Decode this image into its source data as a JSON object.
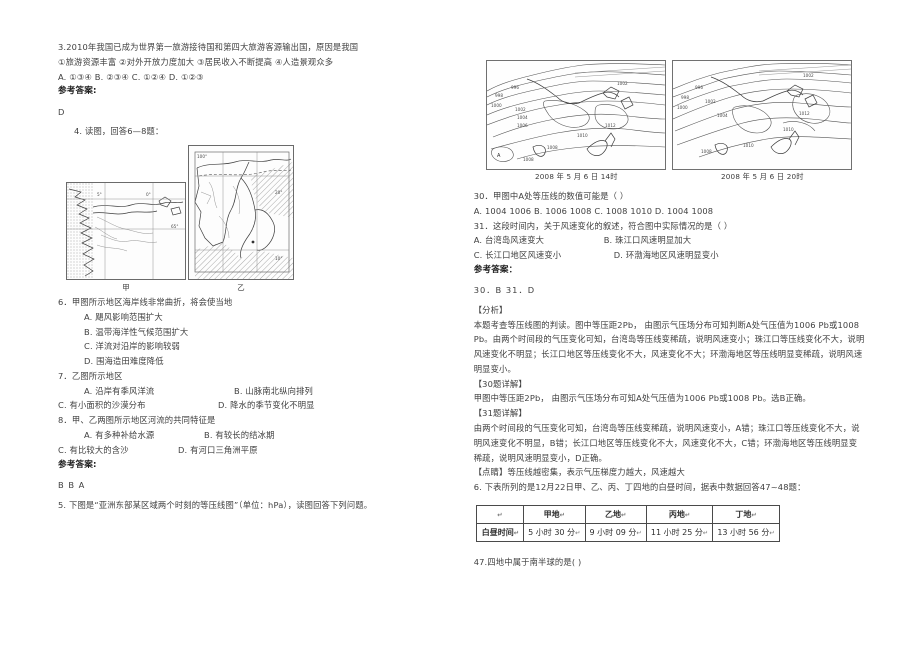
{
  "left_column": {
    "q3": {
      "stem": "3.2010年我国已成为世界第一旅游接待国和第四大旅游客源输出国，原因是我国",
      "choices_line": "①旅游资源丰富        ②对外开放力度加大   ③居民收入不断提高      ④人造景观众多",
      "options_line": "A.  ①③④        B.  ②③④      C.  ①②④      D.  ①②③",
      "answer_label": "参考答案:",
      "answer": "D"
    },
    "q4": {
      "stem": "4. 读图，回答6—8题："
    },
    "figure": {
      "caption_jia": "甲",
      "caption_yi": "乙",
      "jia_labels": [
        "5°",
        "0°",
        "65°"
      ],
      "yi_labels": [
        "100°",
        "20°",
        "10°"
      ]
    },
    "q6": {
      "stem": "6．甲图所示地区海岸线非常曲折，将会使当地",
      "options": [
        "A. 飓风影响范围扩大",
        "B. 温带海洋性气候范围扩大",
        "C. 洋流对沿岸的影响较弱",
        "D. 围海造田难度降低"
      ]
    },
    "q7": {
      "stem": "7．乙图所示地区",
      "options_row1": [
        "A. 沿岸有季风洋流",
        "B. 山脉南北纵向排列"
      ],
      "options_row2": [
        "C. 有小面积的沙漠分布",
        "D. 降水的季节变化不明显"
      ]
    },
    "q8": {
      "stem": "8．甲、乙两图所示地区河流的共同特征是",
      "options_row1": [
        "A. 有多种补给水源",
        "B. 有较长的结冰期"
      ],
      "options_row2": [
        "C. 有比较大的含沙",
        "D. 有河口三角洲平原"
      ],
      "answer_label": "参考答案:",
      "answer": "B  B A"
    },
    "q5": {
      "stem": "5. 下图是“亚洲东部某区域两个时刻的等压线图”（单位：hPa），读图回答下列问题。"
    }
  },
  "right_column": {
    "figure": {
      "caption_left": "2008 年 5 月 6 日 14时",
      "caption_right": "2008 年 5 月 6 日 20时",
      "point_label": "A",
      "isobar_values": [
        "996",
        "998",
        "1000",
        "1002",
        "1004",
        "1006",
        "1008",
        "1010",
        "1012"
      ]
    },
    "q30": {
      "stem": "30．甲图中A处等压线的数值可能是（  ）",
      "options_line": "A.  1004      1006      B.  1006      1008      C.  1008      1010      D.  1004      1008"
    },
    "q31": {
      "stem": "31．这段时间内，关于风速变化的叙述，符合图中实际情况的是（  ）",
      "options_row1": [
        "A.  台湾岛风速变大",
        "B.  珠江口风速明显加大"
      ],
      "options_row2": [
        "C.  长江口地区风速变小",
        "D.  环渤海地区风速明显变小"
      ]
    },
    "answer_label": "参考答案：",
    "answers": "30．B     31．D",
    "analysis_title": "【分析】",
    "analysis_body": "本题考查等压线图的判读。图中等压距2Pb，  由图示气压场分布可知判断A处气压值为1006 Pb或1008 Pb。由两个时间段的气压变化可知，台湾岛等压线变稀疏，说明风速变小；珠江口等压线变化不大，说明风速变化不明显；长江口地区等压线变化不大，风速变化不大；环渤海地区等压线明显变稀疏，说明风速明显变小。",
    "detail30_title": "【30题详解】",
    "detail30_body": "甲图中等压距2Pb，  由图示气压场分布可知A处气压值为1006 Pb或1008 Pb。选B正确。",
    "detail31_title": "【31题详解】",
    "detail31_body": "由两个时间段的气压变化可知，台湾岛等压线变稀疏，说明风速变小，A错；珠江口等压线变化不大，说明风速变化不明显，B错；长江口地区等压线变化不大，风速变化不大，C错；环渤海地区等压线明显变稀疏，说明风速明显变小，D正确。",
    "tip_title": "【点睛】",
    "tip_body": "等压线越密集，表示气压梯度力越大，风速越大",
    "q6": {
      "stem": "6. 下表所列的是12月22日甲、乙、丙、丁四地的白昼时间，据表中数据回答47~48题："
    },
    "table": {
      "headers": [
        "",
        "甲地",
        "乙地",
        "丙地",
        "丁地"
      ],
      "row_label": "白昼时间",
      "values": [
        "5 小时 30 分",
        "9 小时 09 分",
        "11 小时 25 分",
        "13 小时 56 分"
      ]
    },
    "q47": {
      "stem": "47.四地中属于南半球的是(  )"
    }
  }
}
